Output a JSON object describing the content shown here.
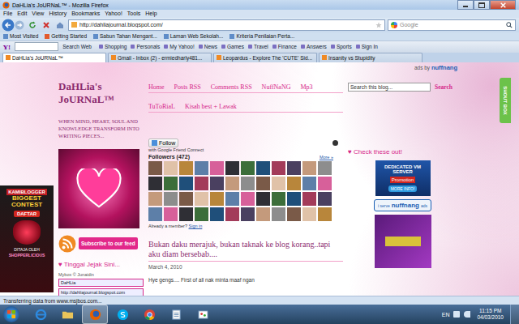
{
  "window": {
    "title": "DaHLia's JoURNaL™ - Mozilla Firefox"
  },
  "menu": [
    "File",
    "Edit",
    "View",
    "History",
    "Bookmarks",
    "Yahoo!",
    "Tools",
    "Help"
  ],
  "address": {
    "url": "http://dahliajournal.blogspot.com/",
    "search_placeholder": "Google"
  },
  "bookmarks": [
    "Most Visited",
    "Getting Started",
    "Sabun Tahan Mengant...",
    "Laman Web Sekolah...",
    "Kriteria Penilaian Perta..."
  ],
  "yahoo_toolbar": {
    "logo": "Y!",
    "search_label": "Search Web",
    "items": [
      "Shopping",
      "Personals",
      "My Yahoo!",
      "News",
      "Games",
      "Travel",
      "Finance",
      "Answers",
      "Sports",
      "Sign In"
    ]
  },
  "tabs": [
    {
      "label": "DaHLia's JoURNaL™",
      "selected": true
    },
    {
      "label": "Gmail - Inbox (2) - ermiedharly481...",
      "selected": false
    },
    {
      "label": "Leopardus - Explore The 'CUTE' Sid...",
      "selected": false
    },
    {
      "label": "Insanity vs Stupidity",
      "selected": false
    }
  ],
  "blog": {
    "title": "DaHLia's JoURNaL™",
    "tagline": "WHEN MIND, HEART, SOUL AND KNOWLEDGE TRANSFORM INTO WRITING PIECES...",
    "nav_rows": [
      [
        "Home",
        "Posts RSS",
        "Comments RSS",
        "NuffNaNG",
        "Mp3"
      ],
      [
        "TuToRiaL",
        "Kisah best + Lawak"
      ]
    ],
    "ads_label": "ads by",
    "ads_brand": "nuffnang",
    "search": {
      "placeholder": "Search this blog...",
      "button": "Search"
    },
    "shout_box": "SHOUT BOX"
  },
  "left_sidebar": {
    "subscribe": "Subscribe to our feed",
    "guestbook_title": "♥ Tinggal Jejak Sini...",
    "credit": "Mybox © Junaidin",
    "fields": [
      "DaHLia",
      "http://dahliajournal.blogspot.com"
    ]
  },
  "followers": {
    "follow": "Follow",
    "connect": "with Google Friend Connect",
    "title": "Followers (472)",
    "more": "More »",
    "member_prompt": "Already a member?",
    "sign_in": "Sign in"
  },
  "post": {
    "title": "Bukan daku merajuk, bukan taknak ke blog korang..tapi aku diam bersebab....",
    "date": "March 4, 2010",
    "excerpt": "Hye gengs.... First of all nak minta maaf ngan"
  },
  "right_sidebar": {
    "heading": "♥ Check these out!",
    "server_ad": [
      "DEDICATED VM SERVER",
      "Promotion",
      "MORE INFO!"
    ],
    "badge": [
      "i serve",
      "nuffnang",
      "ads"
    ]
  },
  "contest_banner": [
    "KAMIBLOGGER",
    "BIGGEST",
    "CONTEST",
    "DAFTAR",
    "DITAJA OLEH",
    "SHOPPERLICIOUS"
  ],
  "status_bar": "Transferring data from www.msjbos.com...",
  "taskbar": {
    "apps": [
      {
        "kind": "ie",
        "active": false
      },
      {
        "kind": "folder",
        "active": false
      },
      {
        "kind": "firefox",
        "active": true
      },
      {
        "kind": "skype",
        "active": false
      },
      {
        "kind": "chrome",
        "active": false
      },
      {
        "kind": "notepad",
        "active": false
      },
      {
        "kind": "paint",
        "active": false
      }
    ],
    "language": "EN",
    "time": "11:15 PM",
    "date": "04/03/2010"
  }
}
